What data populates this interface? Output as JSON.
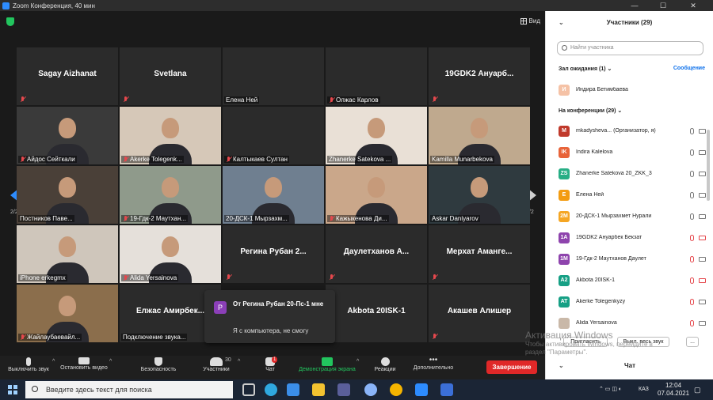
{
  "window": {
    "title": "Zoom Конференция, 40 мин"
  },
  "meeting": {
    "view_label": "Вид",
    "page_left": "2/2",
    "page_right": "2/2",
    "tiles": [
      {
        "name": "Sagay Aizhanat",
        "type": "name",
        "mic_off": true
      },
      {
        "name": "Svetlana",
        "type": "name",
        "mic_off": true
      },
      {
        "name": "Елена Ней",
        "type": "blank",
        "caption": "Елена Ней"
      },
      {
        "name": "Олжас Карлов",
        "type": "blank",
        "caption": "Олжас Карлов",
        "mic_off": true
      },
      {
        "name": "19GDK2 Ануарб...",
        "type": "name",
        "mic_off": true
      },
      {
        "name": "Айдос Сейткали",
        "type": "video",
        "caption": "Айдос Сейткали",
        "mic_off": true,
        "tone": "#3a3a3a"
      },
      {
        "name": "Akerke Tolegenk...",
        "type": "video",
        "caption": "Akerke Tolegenk...",
        "mic_off": true,
        "tone": "#d6c8b8"
      },
      {
        "name": "Калтыкаев Султан",
        "type": "blank",
        "caption": "Калтыкаев Султан",
        "mic_off": true
      },
      {
        "name": "Zhanerke Satekova ...",
        "type": "video",
        "caption": "Zhanerke Satekova ...",
        "active": true,
        "tone": "#e9e0d6"
      },
      {
        "name": "Kamilla Munarbekova",
        "type": "video",
        "caption": "Kamilla Munarbekova",
        "tone": "#bfa98e"
      },
      {
        "name": "Постников Паве...",
        "type": "video",
        "caption": "Постников Паве...",
        "tone": "#4a4038"
      },
      {
        "name": "19-Гдк-2 Маутхан...",
        "type": "video",
        "caption": "19-Гдк-2 Маутхан...",
        "mic_off": true,
        "tone": "#8f9a8b"
      },
      {
        "name": "20-ДСК-1 Мырзахм...",
        "type": "video",
        "caption": "20-ДСК-1 Мырзахм...",
        "tone": "#6f7f90"
      },
      {
        "name": "Кажыкенова Ди...",
        "type": "video",
        "caption": "Кажыкенова Ди...",
        "mic_off": true,
        "tone": "#caa78a"
      },
      {
        "name": "Askar Daniyarov",
        "type": "video",
        "caption": "Askar Daniyarov",
        "tone": "#2f3a3f"
      },
      {
        "name": "iPhone erkegmx",
        "type": "video",
        "caption": "iPhone erkegmx",
        "tone": "#cfc6bb"
      },
      {
        "name": "Alida Yersainova",
        "type": "video",
        "caption": "Alida Yersainova",
        "mic_off": true,
        "tone": "#e5e0da"
      },
      {
        "name": "Регина Рубан 2...",
        "type": "name",
        "mic_off": true
      },
      {
        "name": "Даулетханов А...",
        "type": "name",
        "mic_off": true
      },
      {
        "name": "Мерхат Амангe...",
        "type": "name",
        "mic_off": true
      },
      {
        "name": "Жайлаубаевайл...",
        "type": "video",
        "caption": "Жайлаубаевайл...",
        "mic_off": true,
        "tone": "#8b6e4c"
      },
      {
        "name": "Елжас Амирбек...",
        "type": "name",
        "caption": "Подключение звука...",
        "mic_off": false
      },
      {
        "name": "",
        "type": "hidden"
      },
      {
        "name": "Akbota 20ISK-1",
        "type": "name",
        "mic_off": true
      },
      {
        "name": "Акашев Алишер",
        "type": "name",
        "mic_off": true
      }
    ]
  },
  "chat_popup": {
    "avatar": "P",
    "title": "От Регина Рубан 20-Пс-1 мне",
    "message": "Я с компьютера, не смогу"
  },
  "toolbar": {
    "mute": "Выключить звук",
    "video": "Остановить видео",
    "security": "Безопасность",
    "participants": "Участники",
    "participants_count": "30",
    "chat": "Чат",
    "chat_badge": "1",
    "share": "Демонстрация экрана",
    "reactions": "Реакции",
    "more": "Дополнительно",
    "end": "Завершение"
  },
  "panel": {
    "title": "Участники (29)",
    "search_placeholder": "Найти участника",
    "waiting_label": "Зал ожидания (1)",
    "admit_label": "Сообщение",
    "waiting": [
      {
        "initials": "И",
        "name": "Индира Бетимбаева",
        "color": "#f5c2a6"
      }
    ],
    "in_meeting_label": "На конференции (29)",
    "participants": [
      {
        "initials": "M",
        "name": "mkadysheva... (Организатор, я)",
        "color": "#c0392b",
        "mic_off": false,
        "cam_off": false
      },
      {
        "initials": "IK",
        "name": "Indira Kalelova",
        "color": "#e8643a",
        "mic_off": false,
        "cam_off": false
      },
      {
        "initials": "ZS",
        "name": "Zhanerke Satekova 20_ZKK_3",
        "color": "#27ae85",
        "mic_off": false,
        "cam_off": false
      },
      {
        "initials": "E",
        "name": "Елена Ней",
        "color": "#f39c12",
        "mic_off": false,
        "cam_off": false
      },
      {
        "initials": "2M",
        "name": "20-ДСК-1 Мырзахмет Нурали",
        "color": "#f5a623",
        "mic_off": false,
        "cam_off": false
      },
      {
        "initials": "1A",
        "name": "19GDK2 Ануарбек Бекзат",
        "color": "#8e44ad",
        "mic_off": true,
        "cam_off": true
      },
      {
        "initials": "1M",
        "name": "19-Гдк-2 Маутханов Даулет",
        "color": "#8e44ad",
        "mic_off": true,
        "cam_off": false
      },
      {
        "initials": "A2",
        "name": "Akbota 20ISK-1",
        "color": "#16a085",
        "mic_off": true,
        "cam_off": true
      },
      {
        "initials": "AT",
        "name": "Akerke Tolegenkyzy",
        "color": "#16a085",
        "mic_off": true,
        "cam_off": false
      },
      {
        "initials": "",
        "name": "Alida Yersainova",
        "color": "#c9b8a8",
        "mic_off": true,
        "cam_off": false
      }
    ],
    "invite_label": "Пригласить",
    "mute_all_label": "Выкл. весь звук",
    "more_label": "...",
    "chat_label": "Чат"
  },
  "watermark": {
    "line1": "Активация Windows",
    "line2": "Чтобы активировать Windows, перейдите в",
    "line3": "раздел \"Параметры\"."
  },
  "taskbar": {
    "search_placeholder": "Введите здесь текст для поиска",
    "lang": "КАЗ",
    "time": "12:04",
    "date": "07.04.2021"
  }
}
